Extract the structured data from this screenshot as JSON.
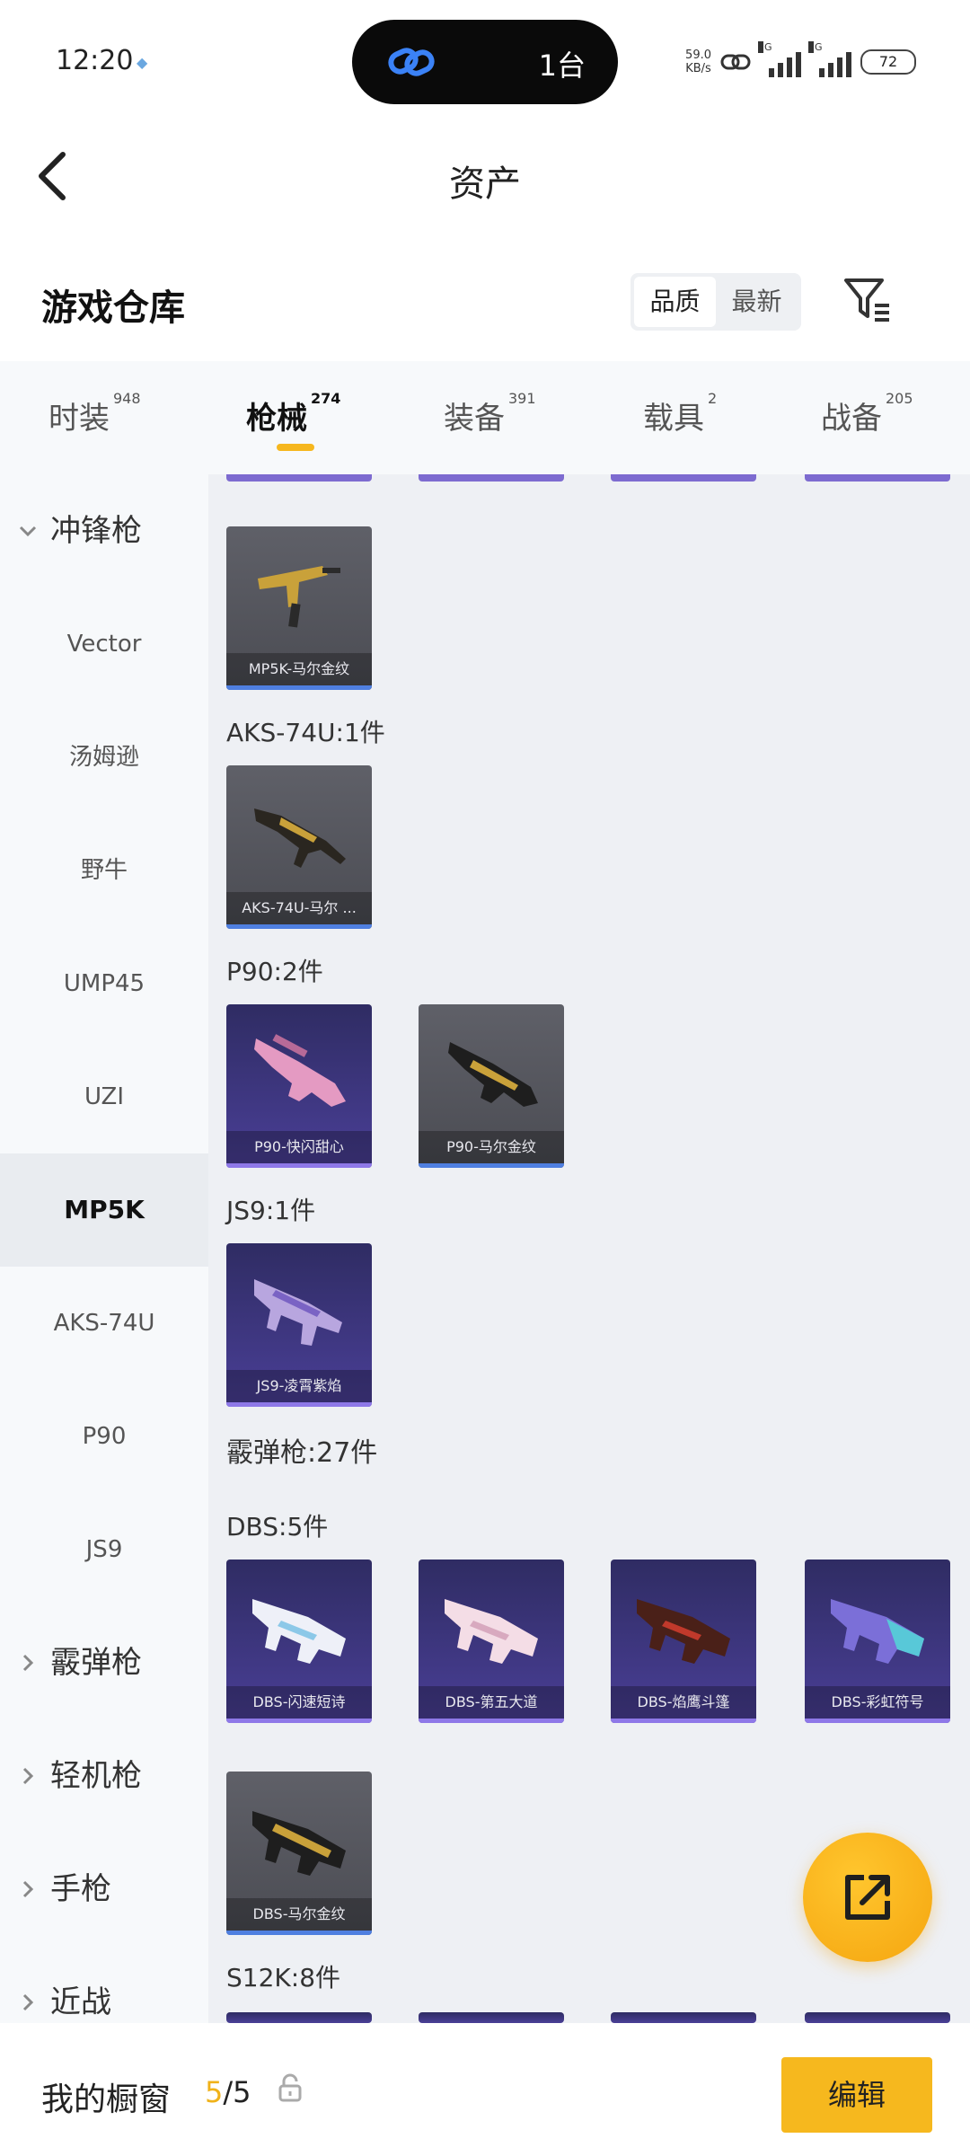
{
  "status_bar": {
    "time": "12:20",
    "island_text": "1台",
    "net_speed_value": "59.0",
    "net_speed_unit": "KB/s",
    "signal1_label": "5G",
    "signal2_label": "5G",
    "battery": "72"
  },
  "header": {
    "title": "资产"
  },
  "warehouse": {
    "title": "游戏仓库",
    "sort_options": [
      "品质",
      "最新"
    ],
    "sort_selected": "品质"
  },
  "tabs": [
    {
      "label": "时装",
      "count": "948"
    },
    {
      "label": "枪械",
      "count": "274",
      "active": true
    },
    {
      "label": "装备",
      "count": "391"
    },
    {
      "label": "载具",
      "count": "2"
    },
    {
      "label": "战备",
      "count": "205"
    }
  ],
  "sidebar": {
    "items": [
      {
        "label": "冲锋枪",
        "type": "group",
        "expanded": true
      },
      {
        "label": "Vector"
      },
      {
        "label": "汤姆逊"
      },
      {
        "label": "野牛"
      },
      {
        "label": "UMP45"
      },
      {
        "label": "UZI"
      },
      {
        "label": "MP5K",
        "active": true
      },
      {
        "label": "AKS-74U"
      },
      {
        "label": "P90"
      },
      {
        "label": "JS9"
      },
      {
        "label": "霰弹枪",
        "type": "group"
      },
      {
        "label": "轻机枪",
        "type": "group"
      },
      {
        "label": "手枪",
        "type": "group"
      },
      {
        "label": "近战",
        "type": "group"
      }
    ]
  },
  "content": {
    "sections": [
      {
        "label": "",
        "cards": [
          {
            "name": "MP5K-马尔金纹",
            "style": "gray"
          }
        ]
      },
      {
        "label": "AKS-74U:1件",
        "cards": [
          {
            "name": "AKS-74U-马尔 ...",
            "style": "gray"
          }
        ]
      },
      {
        "label": "P90:2件",
        "cards": [
          {
            "name": "P90-快闪甜心",
            "style": "purple"
          },
          {
            "name": "P90-马尔金纹",
            "style": "gray"
          }
        ]
      },
      {
        "label": "JS9:1件",
        "cards": [
          {
            "name": "JS9-凌霄紫焰",
            "style": "purple"
          }
        ]
      },
      {
        "label": "霰弹枪:27件",
        "cards": []
      },
      {
        "label": "DBS:5件",
        "cards": [
          {
            "name": "DBS-闪速短诗",
            "style": "purple"
          },
          {
            "name": "DBS-第五大道",
            "style": "purple"
          },
          {
            "name": "DBS-焰鹰斗篷",
            "style": "purple"
          },
          {
            "name": "DBS-彩虹符号",
            "style": "purple"
          }
        ]
      },
      {
        "label": "",
        "cards": [
          {
            "name": "DBS-马尔金纹",
            "style": "gray"
          }
        ]
      },
      {
        "label": "S12K:8件",
        "cards": []
      }
    ]
  },
  "bottom_bar": {
    "label": "我的橱窗",
    "count_current": "5",
    "count_sep_total": "/5",
    "edit_label": "编辑"
  },
  "colors": {
    "accent": "#f6b81e",
    "tab_underline": "#f6b71e",
    "sidebar_bg": "#f7f9fb",
    "content_bg": "#eef0f4",
    "card_purple": "#3b3580",
    "card_gray": "#55565d"
  },
  "icons": {
    "back": "chevron-left-icon",
    "filter": "filter-icon",
    "share": "share-external-icon",
    "lock": "lock-icon",
    "island": "link-chain-icon"
  }
}
